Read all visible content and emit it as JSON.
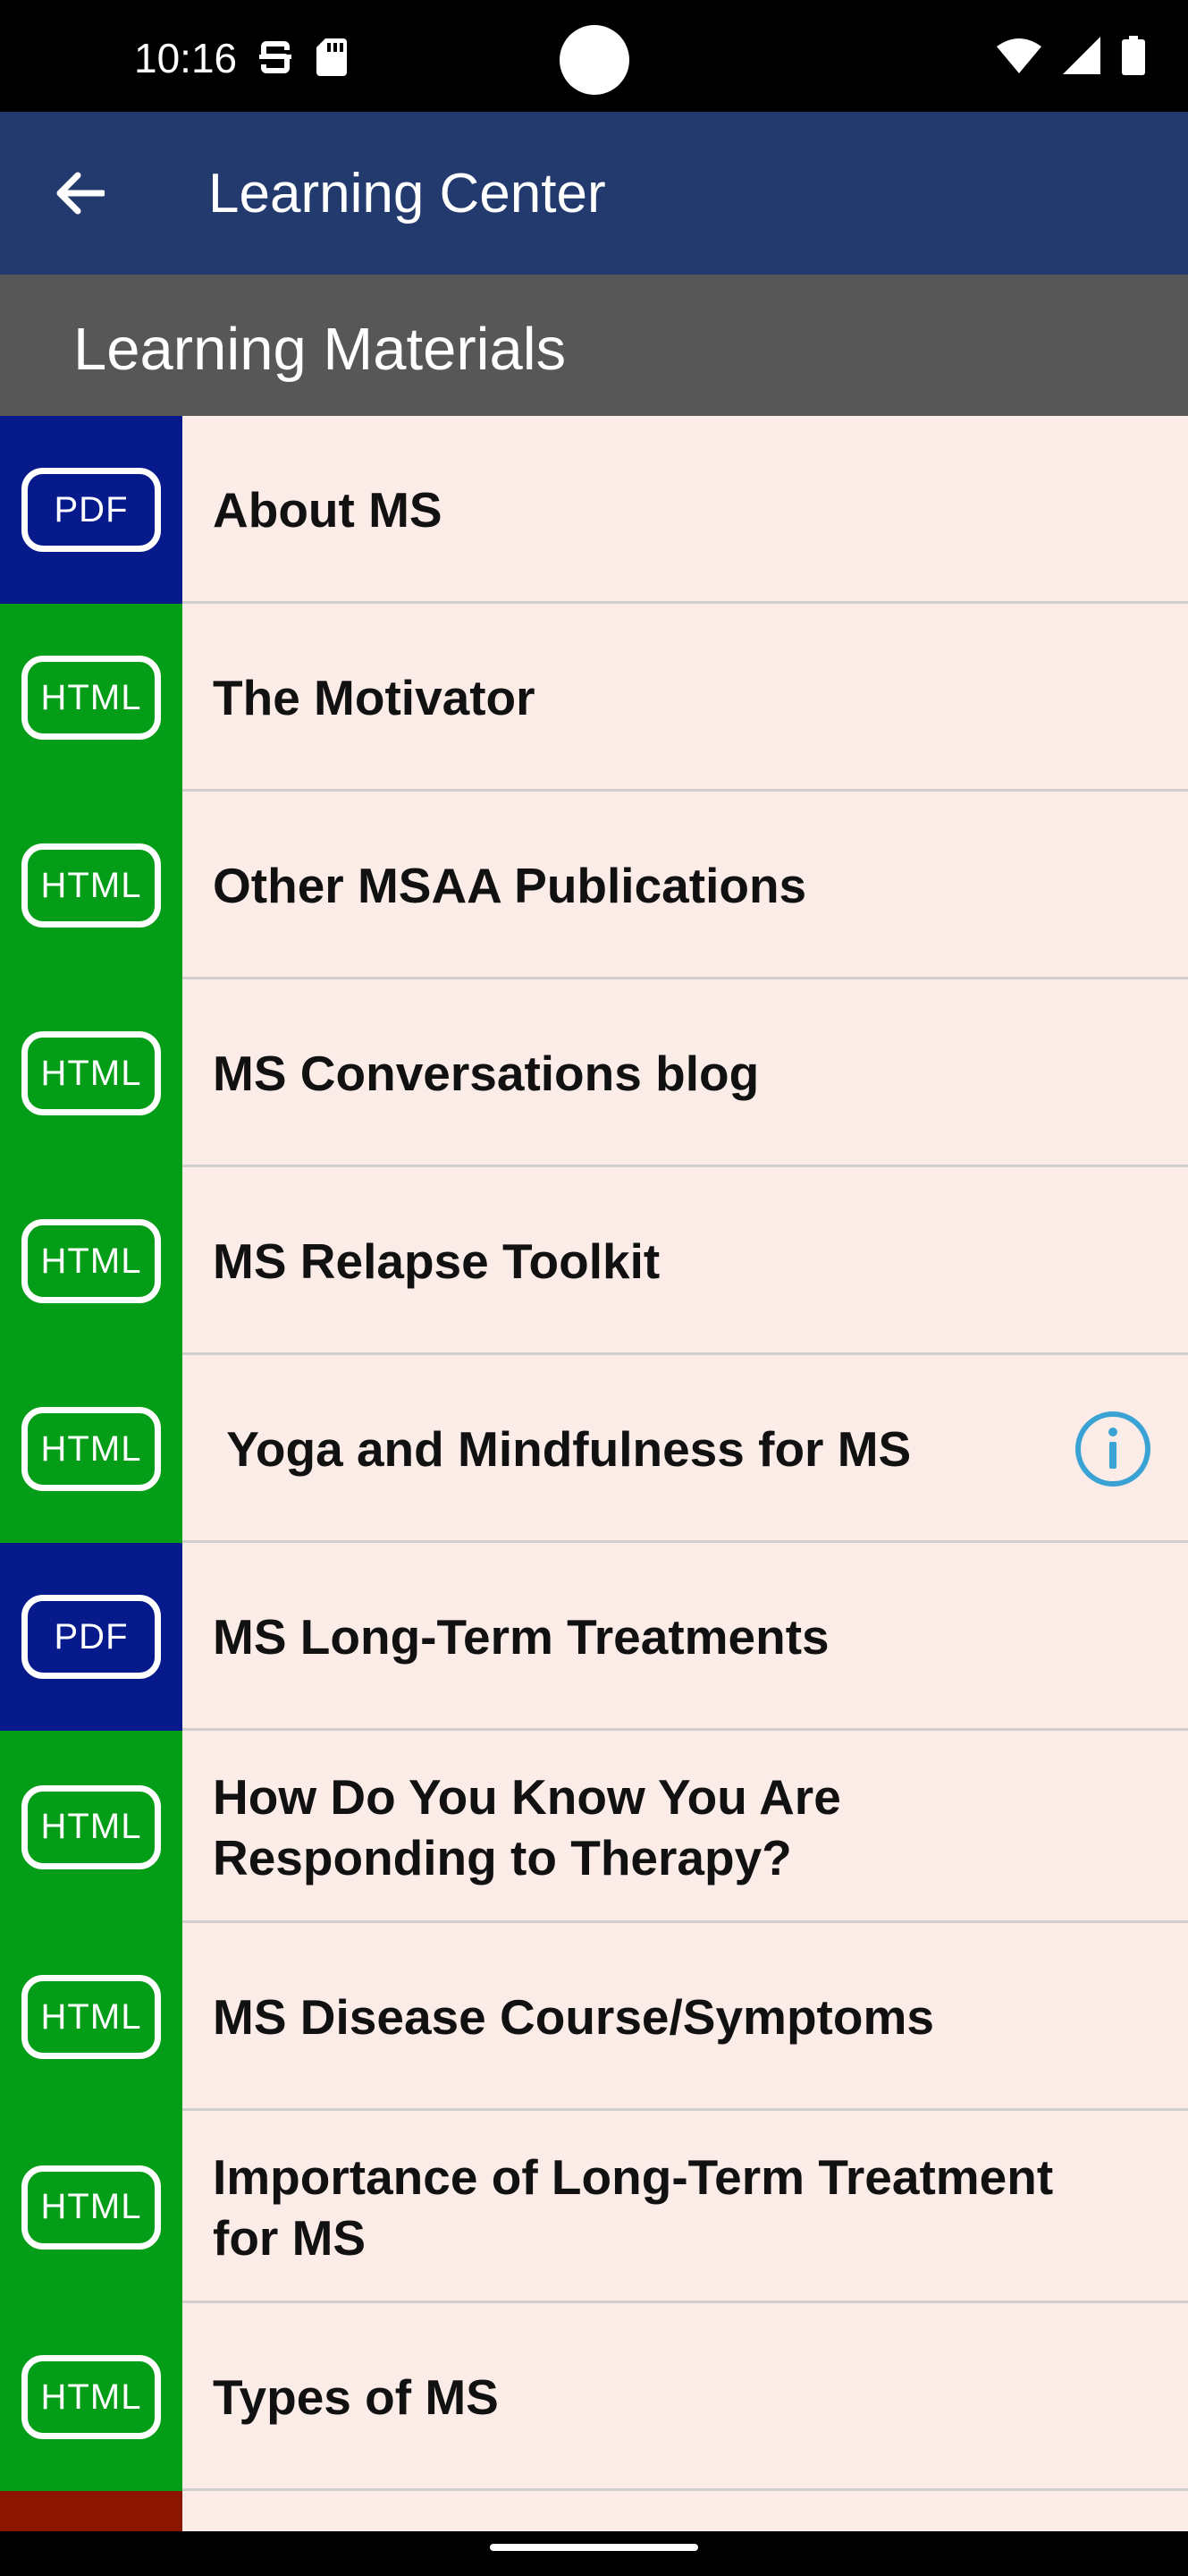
{
  "status_bar": {
    "time": "10:16",
    "left_icons": [
      "sim-notification-icon",
      "sd-card-icon"
    ],
    "right_icons": [
      "wifi-icon",
      "signal-icon",
      "battery-icon"
    ]
  },
  "app_bar": {
    "title": "Learning Center",
    "back_icon": "arrow-left-icon",
    "color": "#223a6d"
  },
  "section": {
    "title": "Learning Materials",
    "color": "#575757"
  },
  "colors": {
    "pdf": "#061a8c",
    "html": "#049d17",
    "partial_row": "#8c1500",
    "list_background": "#fbece8",
    "info_icon": "#3aa3d4"
  },
  "items": [
    {
      "type": "PDF",
      "title": "About MS"
    },
    {
      "type": "HTML",
      "title": "The Motivator"
    },
    {
      "type": "HTML",
      "title": "Other MSAA Publications"
    },
    {
      "type": "HTML",
      "title": "MS Conversations blog"
    },
    {
      "type": "HTML",
      "title": "MS Relapse Toolkit"
    },
    {
      "type": "HTML",
      "title": " Yoga and Mindfulness for MS",
      "has_info": true
    },
    {
      "type": "PDF",
      "title": "MS Long-Term Treatments"
    },
    {
      "type": "HTML",
      "title": "How Do You Know You Are Responding to Therapy?"
    },
    {
      "type": "HTML",
      "title": "MS Disease Course/Symptoms"
    },
    {
      "type": "HTML",
      "title": "Importance of Long-Term Treatment for MS"
    },
    {
      "type": "HTML",
      "title": "Types of MS"
    }
  ]
}
